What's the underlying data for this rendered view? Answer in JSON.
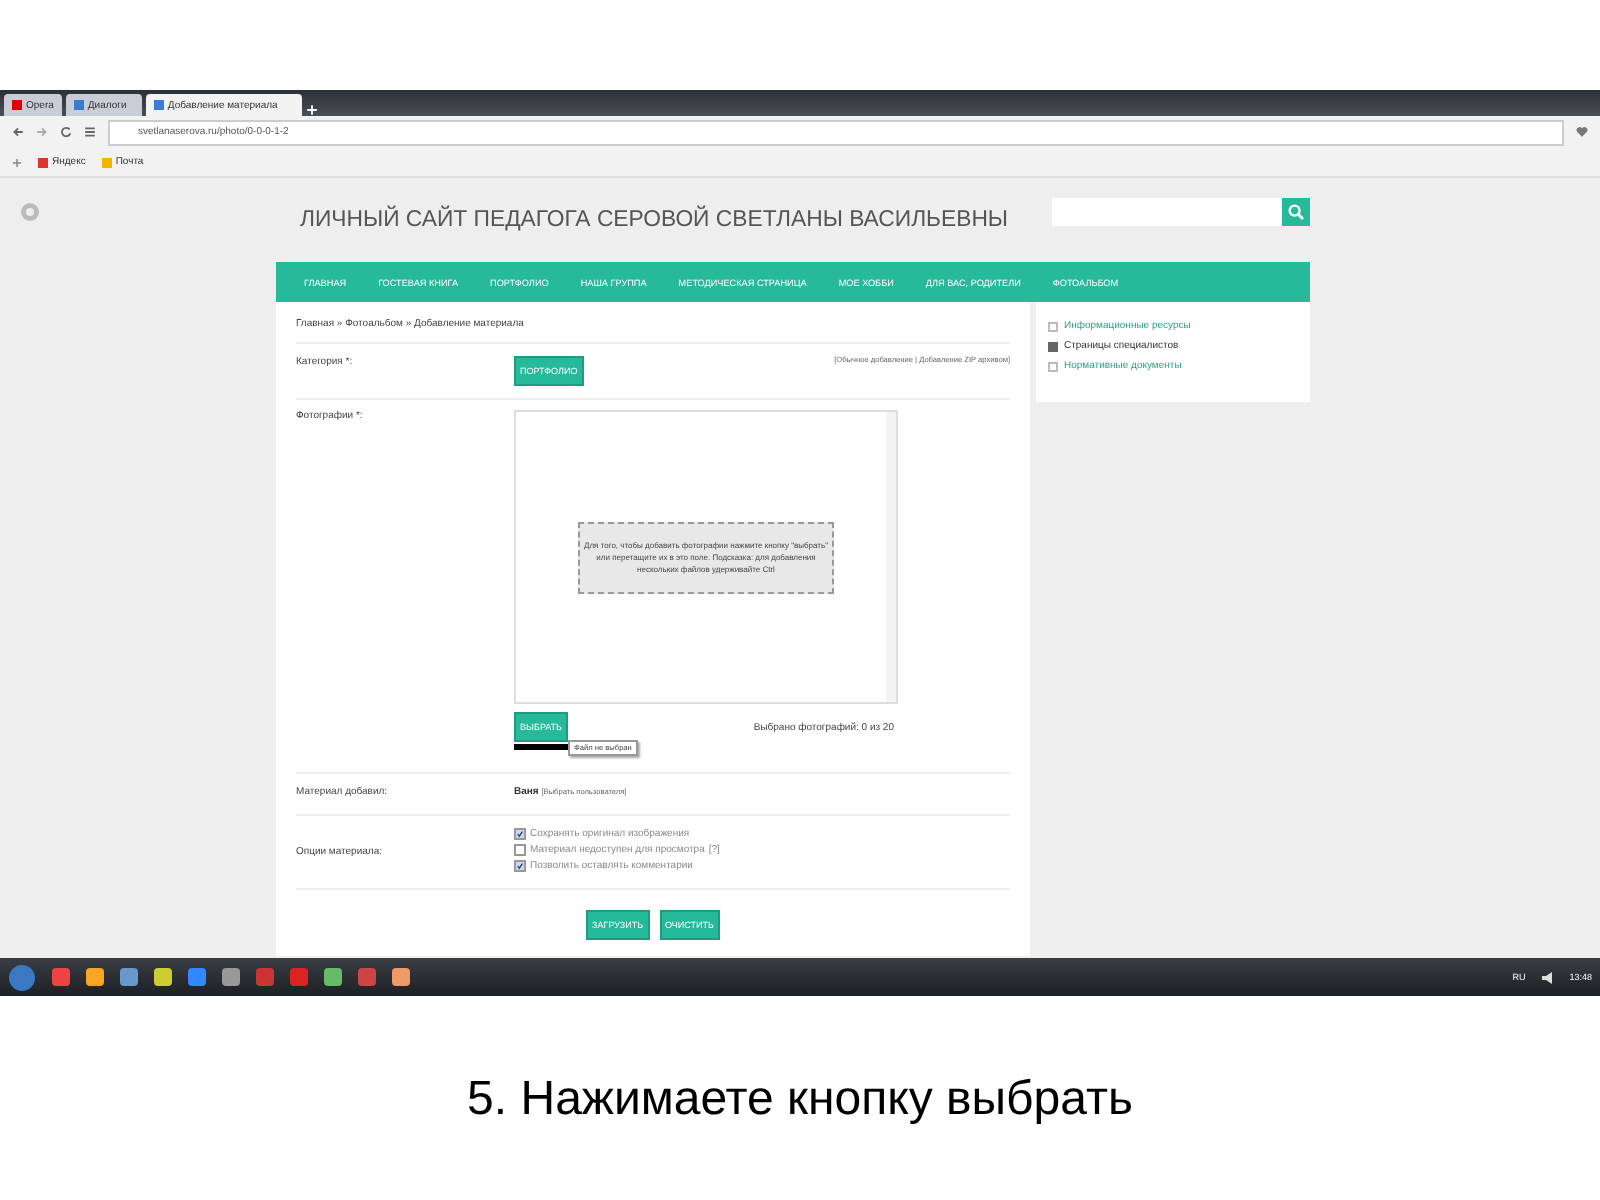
{
  "browser": {
    "tabs": [
      {
        "label": "Opera",
        "selected": false
      },
      {
        "label": "Диалоги",
        "selected": false
      },
      {
        "label": "Добавление материала",
        "selected": true
      }
    ],
    "address": "svetlanaserova.ru/photo/0-0-0-1-2",
    "bookmarks": [
      "Яндекс",
      "Почта"
    ]
  },
  "site": {
    "title": "ЛИЧНЫЙ САЙТ ПЕДАГОГА СЕРОВОЙ СВЕТЛАНЫ ВАСИЛЬЕВНЫ",
    "nav": [
      "ГЛАВНАЯ",
      "ГОСТЕВАЯ КНИГА",
      "ПОРТФОЛИО",
      "НАША ГРУППА",
      "МЕТОДИЧЕСКАЯ СТРАНИЦА",
      "МОЕ ХОББИ",
      "ДЛЯ ВАС, РОДИТЕЛИ",
      "ФОТОАЛЬБОМ"
    ],
    "breadcrumb": "Главная » Фотоальбом » Добавление материала",
    "form": {
      "category_label": "Категория *:",
      "category": "ПОРТФОЛИО",
      "mode_links": "[Обычное добавление | Добавление ZIP архивом]",
      "photos_label": "Фотографии *:",
      "drop_hint": "Для того, чтобы добавить фотографии нажмите кнопку \"выбрать\" или перетащите их в это поле. Подсказка: для добавления нескольких файлов удерживайте Ctrl",
      "select_button": "ВЫБРАТЬ",
      "tooltip": "Файл не выбран",
      "count": "Выбрано фотографий: 0 из 20",
      "author_label": "Материал добавил:",
      "author": "Ваня",
      "author_link": "[Выбрать пользователя]",
      "options_label": "Опции материала:",
      "options": [
        {
          "label": "Сохранять оригинал изображения",
          "checked": true
        },
        {
          "label": "Материал недоступен для просмотра",
          "checked": false,
          "help": "[?]"
        },
        {
          "label": "Позволить оставлять комментарии",
          "checked": true
        }
      ],
      "buttons": [
        "ЗАГРУЗИТЬ",
        "ОЧИСТИТЬ"
      ]
    },
    "sidebar": [
      {
        "label": "Информационные ресурсы",
        "selected": false
      },
      {
        "label": "Страницы специалистов",
        "selected": true
      },
      {
        "label": "Нормативные документы",
        "selected": false
      }
    ]
  },
  "taskbar": {
    "language": "RU",
    "clock": "13:48"
  },
  "caption": "5. Нажимаете кнопку выбрать"
}
